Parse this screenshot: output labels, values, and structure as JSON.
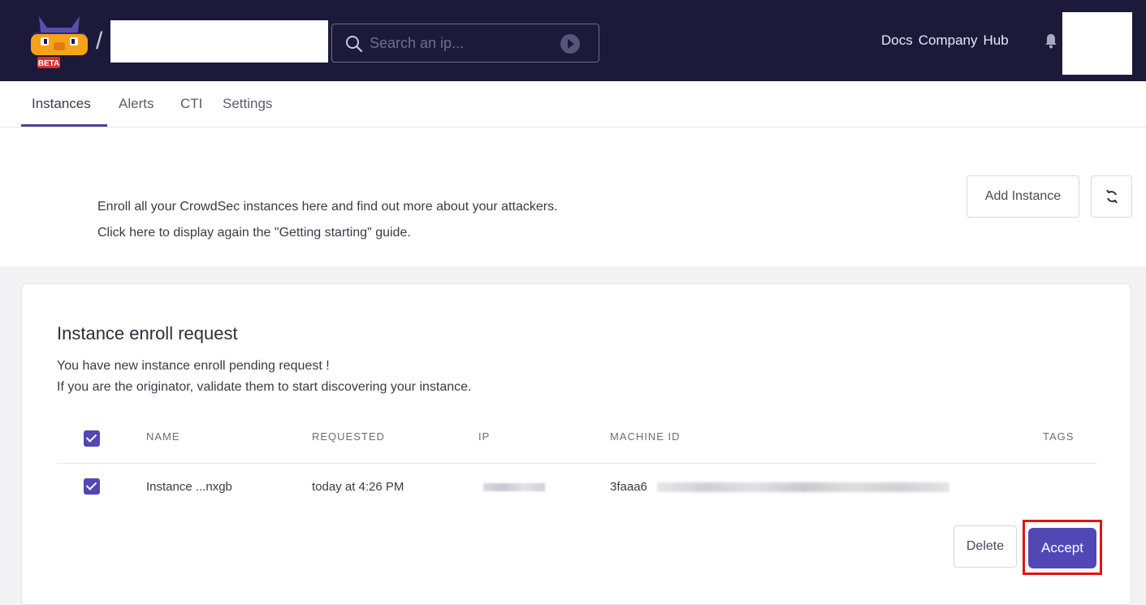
{
  "search": {
    "placeholder": "Search an ip..."
  },
  "header": {
    "slash": "/",
    "logo_badge": "BETA",
    "nav": [
      "Docs",
      "Company",
      "Hub"
    ]
  },
  "tabs": [
    {
      "label": "Instances",
      "active": true
    },
    {
      "label": "Alerts",
      "active": false
    },
    {
      "label": "CTI",
      "active": false
    },
    {
      "label": "Settings",
      "active": false
    }
  ],
  "intro": {
    "line1": "Enroll all your CrowdSec instances here and find out more about your attackers.",
    "line2": "Click here to display again the \"Getting starting\" guide.",
    "add_instance_label": "Add Instance",
    "refresh_icon": "refresh-icon"
  },
  "enroll": {
    "title": "Instance enroll request",
    "text1": "You have new instance enroll pending request !",
    "text2": "If you are the originator, validate them to start discovering your instance.",
    "columns": [
      "NAME",
      "REQUESTED",
      "IP",
      "MACHINE ID",
      "TAGS"
    ],
    "rows": [
      {
        "checked": true,
        "name": "Instance ...nxgb",
        "requested": "today at 4:26 PM",
        "ip": "",
        "machine_id": "3faaa6",
        "tags": ""
      }
    ],
    "select_all_checked": true,
    "delete_label": "Delete",
    "accept_label": "Accept"
  },
  "colors": {
    "header_bg": "#1b1a3a",
    "accent": "#5148b6",
    "highlight": "#e01414"
  }
}
